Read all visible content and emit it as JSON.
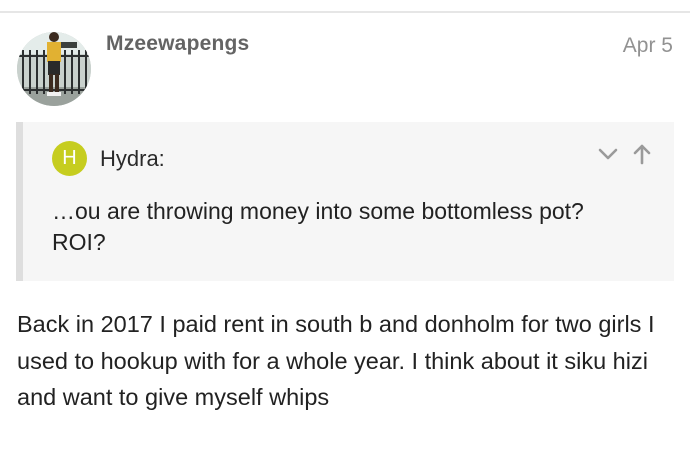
{
  "post": {
    "username": "Mzeewapengs",
    "date": "Apr 5",
    "avatar_icon": "user-avatar-photo",
    "body": "Back in 2017 I paid rent in south b and donholm for two girls I used to hookup with for a whole year. I think about it siku hizi and want to give myself whips"
  },
  "quote": {
    "avatar_letter": "H",
    "avatar_color": "#c6cd1f",
    "author": "Hydra:",
    "lines": [
      "…ou are throwing money into some bottomless pot?",
      "ROI?"
    ],
    "expand_icon": "chevron-down-icon",
    "jump_icon": "arrow-up-icon"
  },
  "colors": {
    "username": "#646464",
    "date": "#929292",
    "quote_background": "#f6f6f6",
    "quote_border": "#dedede"
  }
}
